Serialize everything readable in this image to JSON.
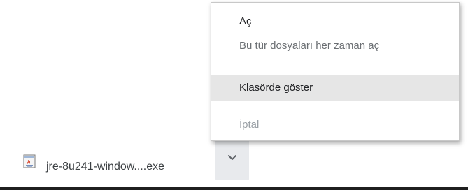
{
  "download_shelf": {
    "file_name": "jre-8u241-window....exe",
    "file_icon": "java-installer-icon",
    "chevron_icon": "chevron-down-icon"
  },
  "context_menu": {
    "items": [
      {
        "label": "Aç",
        "state": "enabled"
      },
      {
        "label": "Bu tür dosyaları her zaman aç",
        "state": "enabled"
      },
      {
        "label": "Klasörde göster",
        "state": "highlighted"
      },
      {
        "label": "İptal",
        "state": "disabled"
      }
    ]
  },
  "colors": {
    "shelf_background": "#ffffff",
    "chevron_background": "#e8eaed",
    "menu_highlight": "#e6e6e6",
    "disabled_text": "#9aa0a6"
  }
}
